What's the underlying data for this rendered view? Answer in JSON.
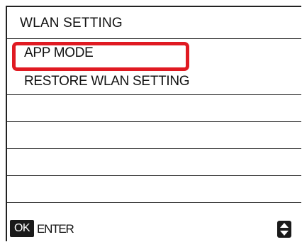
{
  "header": {
    "title": "WLAN SETTING"
  },
  "menu": {
    "items": [
      {
        "label": "APP MODE",
        "selected": true
      },
      {
        "label": "RESTORE WLAN SETTING",
        "selected": false
      },
      {
        "label": "",
        "selected": false
      },
      {
        "label": "",
        "selected": false
      },
      {
        "label": "",
        "selected": false
      },
      {
        "label": "",
        "selected": false
      }
    ]
  },
  "footer": {
    "ok_label": "OK",
    "enter_label": "ENTER",
    "nav_icon": "up-down-arrows-icon"
  },
  "colors": {
    "selection_outline": "#e01a22",
    "line": "#222222",
    "badge_bg": "#1a1a1a"
  }
}
